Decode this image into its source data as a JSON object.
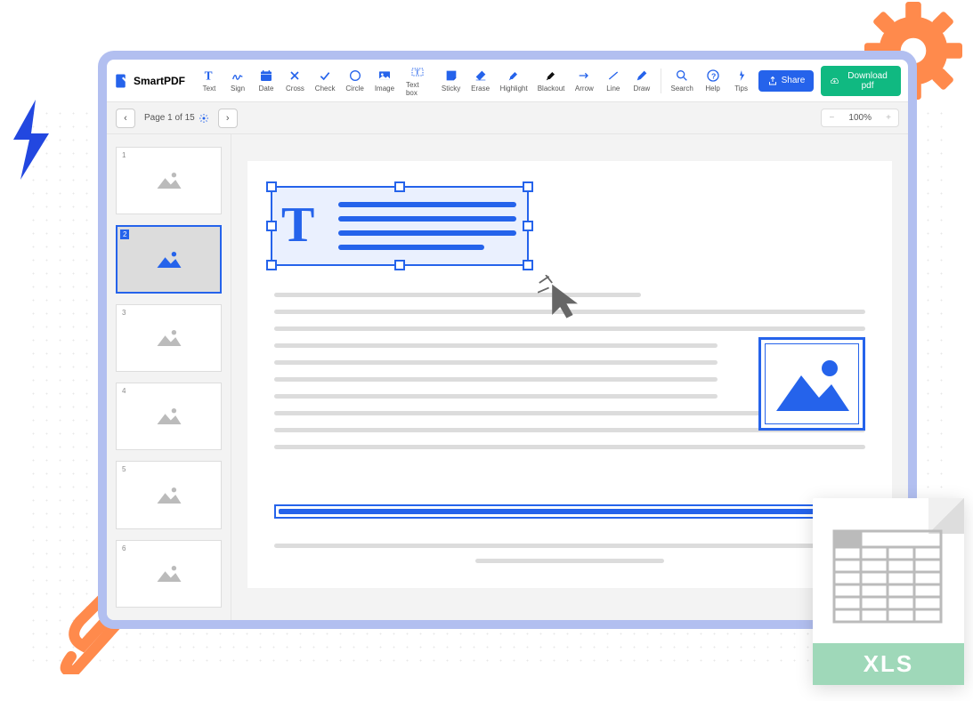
{
  "app": {
    "name": "SmartPDF"
  },
  "toolbar": {
    "tools": [
      {
        "label": "Text"
      },
      {
        "label": "Sign"
      },
      {
        "label": "Date"
      },
      {
        "label": "Cross"
      },
      {
        "label": "Check"
      },
      {
        "label": "Circle"
      },
      {
        "label": "Image"
      },
      {
        "label": "Text box"
      },
      {
        "label": "Sticky"
      },
      {
        "label": "Erase"
      },
      {
        "label": "Highlight"
      },
      {
        "label": "Blackout"
      },
      {
        "label": "Arrow"
      },
      {
        "label": "Line"
      },
      {
        "label": "Draw"
      }
    ],
    "utility": [
      {
        "label": "Search"
      },
      {
        "label": "Help"
      },
      {
        "label": "Tips"
      }
    ],
    "share": "Share",
    "download": "Download pdf"
  },
  "nav": {
    "page_label": "Page 1 of 15",
    "zoom": "100%"
  },
  "thumbs": {
    "count": 6,
    "active": 2
  },
  "xls": {
    "label": "XLS"
  }
}
